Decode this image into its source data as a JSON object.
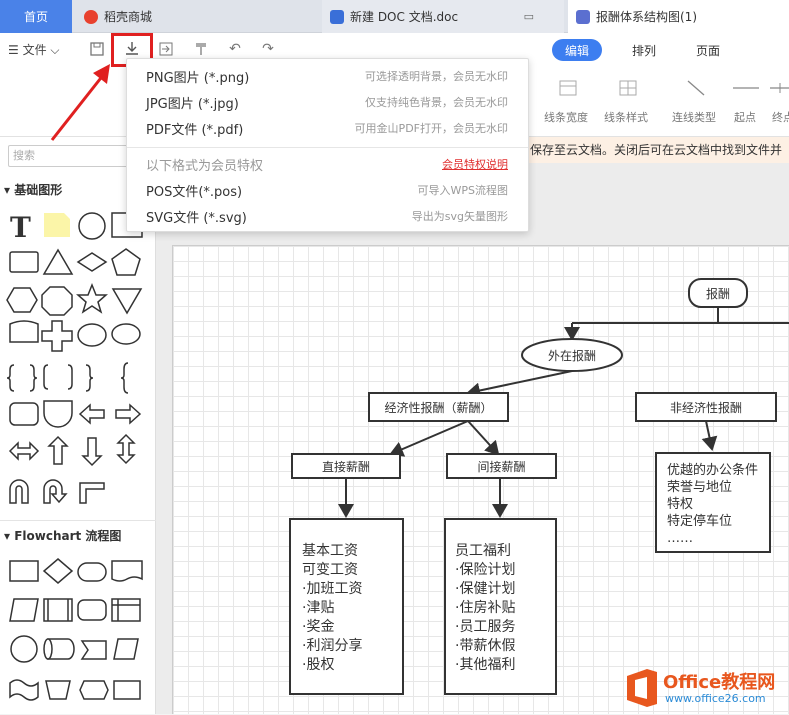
{
  "tabs": [
    {
      "label": "首页"
    },
    {
      "label": "稻壳商城"
    },
    {
      "label": "新建 DOC 文档.doc"
    },
    {
      "label": "报酬体系结构图(1)"
    }
  ],
  "toolbar": {
    "file_label": "☰ 文件 ⌵",
    "right_tabs": [
      "编辑",
      "排列",
      "页面"
    ],
    "tool_labels": [
      "线条宽度",
      "线条样式",
      "连线类型",
      "起点",
      "终点"
    ]
  },
  "notice": "保存至云文档。关闭后可在云文档中找到文件并",
  "search_placeholder": "搜索",
  "sections": {
    "basic": "▾ 基础图形",
    "flowchart": "▾ Flowchart 流程图"
  },
  "export_menu": {
    "items": [
      {
        "name": "PNG图片 (*.png)",
        "desc": "可选择透明背景，会员无水印"
      },
      {
        "name": "JPG图片 (*.jpg)",
        "desc": "仅支持纯色背景，会员无水印"
      },
      {
        "name": "PDF文件 (*.pdf)",
        "desc": "可用金山PDF打开，会员无水印"
      }
    ],
    "member_header": {
      "name": "以下格式为会员特权",
      "desc": "会员特权说明"
    },
    "member_items": [
      {
        "name": "POS文件(*.pos)",
        "desc": "可导入WPS流程图"
      },
      {
        "name": "SVG文件 (*.svg)",
        "desc": "导出为svg矢量图形"
      }
    ]
  },
  "diagram": {
    "root": "报酬",
    "external": "外在报酬",
    "economic": "经济性报酬（薪酬）",
    "non_economic": "非经济性报酬",
    "direct": "直接薪酬",
    "indirect": "间接薪酬",
    "direct_list": [
      "基本工资",
      "可变工资",
      "·加班工资",
      "·津贴",
      "·奖金",
      "·利润分享",
      "·股权"
    ],
    "indirect_list": [
      "员工福利",
      "·保险计划",
      "·保健计划",
      "·住房补贴",
      "·员工服务",
      "·带薪休假",
      "·其他福利"
    ],
    "non_econ_list": [
      "优越的办公条件",
      "荣誉与地位",
      "特权",
      "特定停车位",
      "……"
    ]
  },
  "watermark": {
    "brand": "Office教程网",
    "url": "www.office26.com"
  },
  "colors": {
    "accent": "#3d7ef0",
    "highlight": "#e02020",
    "notice_bg": "#fdf0e4"
  }
}
